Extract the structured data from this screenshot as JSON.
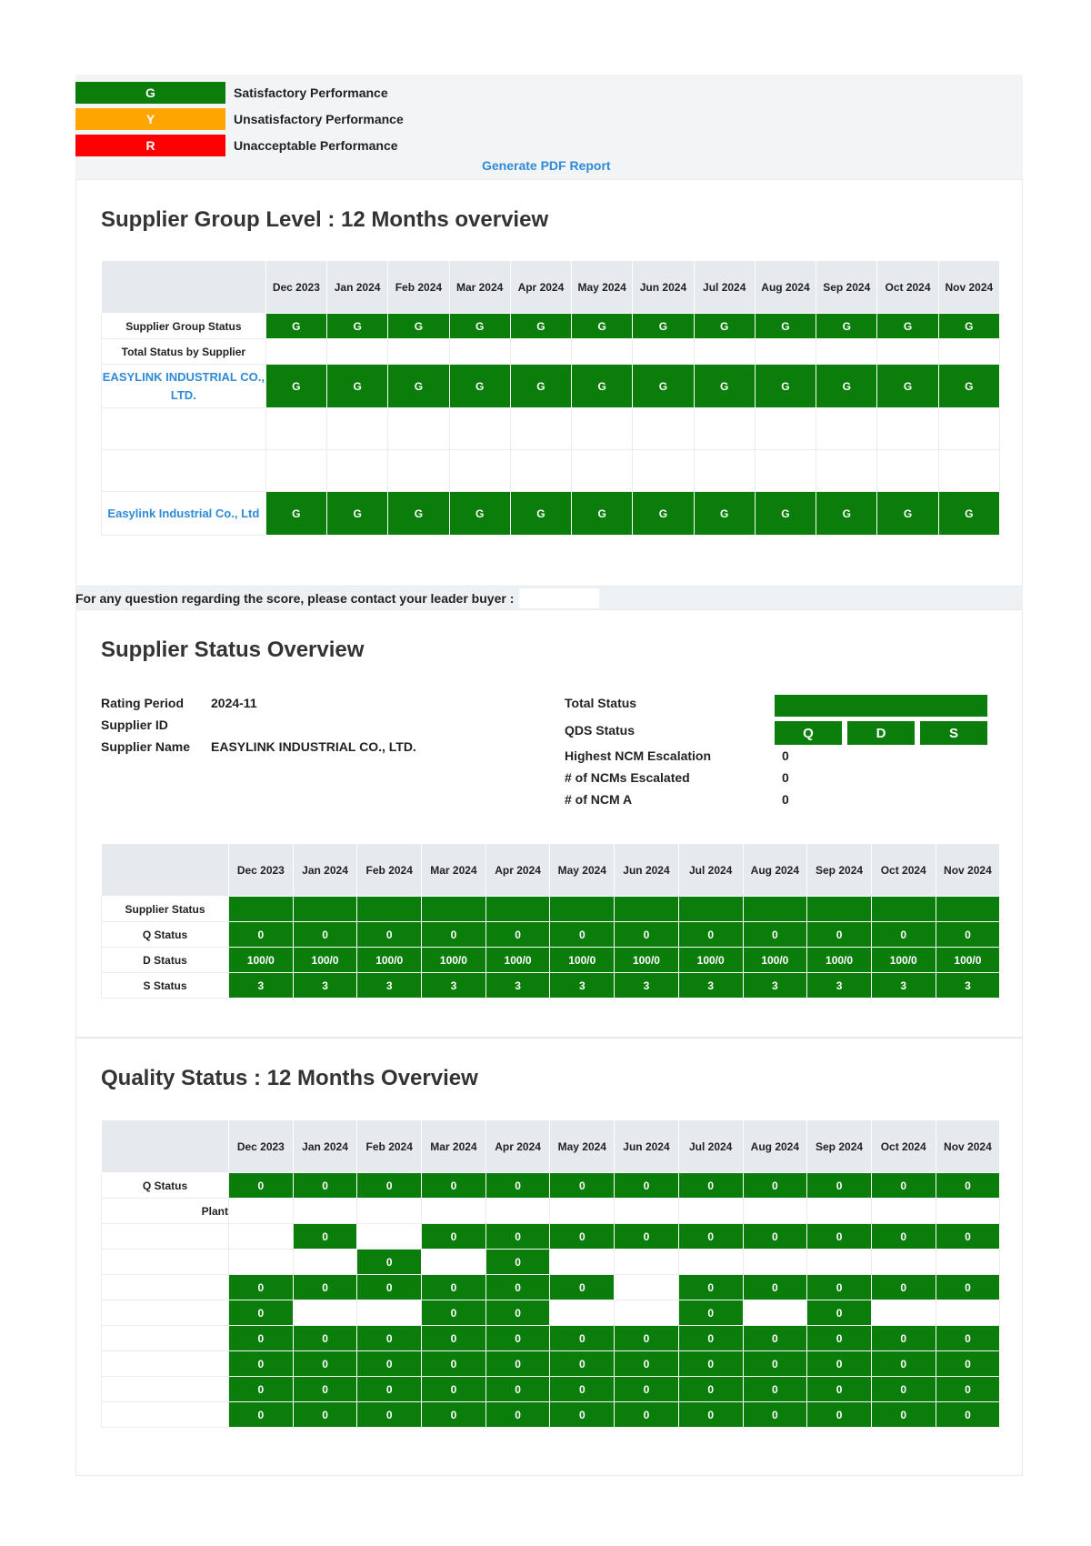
{
  "legend": [
    {
      "code": "G",
      "label": "Satisfactory Performance",
      "color": "#0a7d0a"
    },
    {
      "code": "Y",
      "label": "Unsatisfactory Performance",
      "color": "#ffa500"
    },
    {
      "code": "R",
      "label": "Unacceptable Performance",
      "color": "#ff0000"
    }
  ],
  "pdf_link": "Generate PDF Report",
  "group_level": {
    "title": "Supplier Group Level : 12 Months overview",
    "months": [
      "Dec 2023",
      "Jan 2024",
      "Feb 2024",
      "Mar 2024",
      "Apr 2024",
      "May 2024",
      "Jun 2024",
      "Jul 2024",
      "Aug 2024",
      "Sep 2024",
      "Oct 2024",
      "Nov 2024"
    ],
    "rows": [
      {
        "label": "Supplier Group Status",
        "type": "label",
        "values": [
          "G",
          "G",
          "G",
          "G",
          "G",
          "G",
          "G",
          "G",
          "G",
          "G",
          "G",
          "G"
        ]
      },
      {
        "label": "Total Status by Supplier",
        "type": "label",
        "values": null
      },
      {
        "label": "EASYLINK INDUSTRIAL CO., LTD.",
        "type": "supplier",
        "values": [
          "G",
          "G",
          "G",
          "G",
          "G",
          "G",
          "G",
          "G",
          "G",
          "G",
          "G",
          "G"
        ]
      },
      {
        "label": "",
        "type": "blank",
        "values": null
      },
      {
        "label": "",
        "type": "blank",
        "values": null
      },
      {
        "label": "Easylink Industrial Co., Ltd",
        "type": "supplier",
        "values": [
          "G",
          "G",
          "G",
          "G",
          "G",
          "G",
          "G",
          "G",
          "G",
          "G",
          "G",
          "G"
        ]
      }
    ]
  },
  "notice": "For any question regarding the score, please contact your leader buyer :",
  "status_overview": {
    "title": "Supplier Status Overview",
    "rating_period_label": "Rating Period",
    "rating_period": "2024-11",
    "supplier_id_label": "Supplier ID",
    "supplier_id": "",
    "supplier_name_label": "Supplier Name",
    "supplier_name": "EASYLINK INDUSTRIAL CO., LTD.",
    "total_status_label": "Total Status",
    "qds_status_label": "QDS Status",
    "qds": [
      "Q",
      "D",
      "S"
    ],
    "ncm_escalation_label": "Highest NCM Escalation",
    "ncm_escalation": "0",
    "ncms_escalated_label": "# of NCMs Escalated",
    "ncms_escalated": "0",
    "ncm_a_label": "# of NCM A",
    "ncm_a": "0",
    "months": [
      "Dec 2023",
      "Jan 2024",
      "Feb 2024",
      "Mar 2024",
      "Apr 2024",
      "May 2024",
      "Jun 2024",
      "Jul 2024",
      "Aug 2024",
      "Sep 2024",
      "Oct 2024",
      "Nov 2024"
    ],
    "rows": [
      {
        "label": "Supplier Status",
        "values": [
          "",
          "",
          "",
          "",
          "",
          "",
          "",
          "",
          "",
          "",
          "",
          ""
        ]
      },
      {
        "label": "Q Status",
        "values": [
          "0",
          "0",
          "0",
          "0",
          "0",
          "0",
          "0",
          "0",
          "0",
          "0",
          "0",
          "0"
        ]
      },
      {
        "label": "D Status",
        "values": [
          "100/0",
          "100/0",
          "100/0",
          "100/0",
          "100/0",
          "100/0",
          "100/0",
          "100/0",
          "100/0",
          "100/0",
          "100/0",
          "100/0"
        ]
      },
      {
        "label": "S Status",
        "values": [
          "3",
          "3",
          "3",
          "3",
          "3",
          "3",
          "3",
          "3",
          "3",
          "3",
          "3",
          "3"
        ]
      }
    ]
  },
  "quality": {
    "title": "Quality Status : 12 Months Overview",
    "months": [
      "Dec 2023",
      "Jan 2024",
      "Feb 2024",
      "Mar 2024",
      "Apr 2024",
      "May 2024",
      "Jun 2024",
      "Jul 2024",
      "Aug 2024",
      "Sep 2024",
      "Oct 2024",
      "Nov 2024"
    ],
    "rows": [
      {
        "label": "Q Status",
        "values": [
          "0",
          "0",
          "0",
          "0",
          "0",
          "0",
          "0",
          "0",
          "0",
          "0",
          "0",
          "0"
        ]
      },
      {
        "label": "Plant",
        "values": [
          null,
          null,
          null,
          null,
          null,
          null,
          null,
          null,
          null,
          null,
          null,
          null
        ]
      },
      {
        "label": "",
        "values": [
          null,
          "0",
          null,
          "0",
          "0",
          "0",
          "0",
          "0",
          "0",
          "0",
          "0",
          "0"
        ]
      },
      {
        "label": "",
        "values": [
          null,
          null,
          "0",
          null,
          "0",
          null,
          null,
          null,
          null,
          null,
          null,
          null
        ]
      },
      {
        "label": "",
        "values": [
          "0",
          "0",
          "0",
          "0",
          "0",
          "0",
          null,
          "0",
          "0",
          "0",
          "0",
          "0"
        ]
      },
      {
        "label": "",
        "values": [
          "0",
          null,
          null,
          "0",
          "0",
          null,
          null,
          "0",
          null,
          "0",
          null,
          null
        ]
      },
      {
        "label": "",
        "values": [
          "0",
          "0",
          "0",
          "0",
          "0",
          "0",
          "0",
          "0",
          "0",
          "0",
          "0",
          "0"
        ]
      },
      {
        "label": "",
        "values": [
          "0",
          "0",
          "0",
          "0",
          "0",
          "0",
          "0",
          "0",
          "0",
          "0",
          "0",
          "0"
        ]
      },
      {
        "label": "",
        "values": [
          "0",
          "0",
          "0",
          "0",
          "0",
          "0",
          "0",
          "0",
          "0",
          "0",
          "0",
          "0"
        ]
      },
      {
        "label": "",
        "values": [
          "0",
          "0",
          "0",
          "0",
          "0",
          "0",
          "0",
          "0",
          "0",
          "0",
          "0",
          "0"
        ]
      }
    ]
  }
}
